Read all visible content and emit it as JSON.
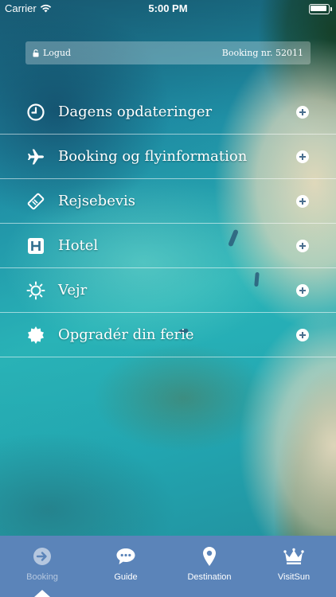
{
  "status_bar": {
    "carrier": "Carrier",
    "time": "5:00 PM",
    "wifi_icon": "wifi-icon",
    "battery_icon": "battery-icon"
  },
  "info_bar": {
    "logout_label": "Logud",
    "logout_icon": "lock-open-icon",
    "booking_text": "Booking nr. 52011"
  },
  "menu": {
    "items": [
      {
        "label": "Dagens opdateringer",
        "icon": "clock-icon"
      },
      {
        "label": "Booking og flyinformation",
        "icon": "airplane-icon"
      },
      {
        "label": "Rejsebevis",
        "icon": "ticket-icon"
      },
      {
        "label": "Hotel",
        "icon": "hotel-icon"
      },
      {
        "label": "Vejr",
        "icon": "sun-icon"
      },
      {
        "label": "Opgradér din ferie",
        "icon": "badge-icon"
      }
    ],
    "expand_icon": "plus-circle-icon"
  },
  "tab_bar": {
    "background": "#5b84b9",
    "tabs": [
      {
        "label": "Booking",
        "icon": "arrow-right-circle-icon",
        "active": true
      },
      {
        "label": "Guide",
        "icon": "chat-bubble-icon",
        "active": false
      },
      {
        "label": "Destination",
        "icon": "map-pin-icon",
        "active": false
      },
      {
        "label": "VisitSun",
        "icon": "crown-icon",
        "active": false
      }
    ]
  }
}
